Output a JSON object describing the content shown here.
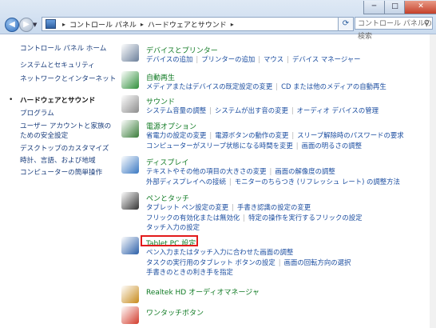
{
  "window": {
    "min_label": "─",
    "max_label": "□",
    "close_label": "✕"
  },
  "nav": {
    "back_glyph": "◀",
    "forward_glyph": "▶",
    "dropdown_glyph": "▼",
    "refresh_glyph": "⟳"
  },
  "address": {
    "sep": "▸",
    "crumbs": [
      "コントロール パネル",
      "ハードウェアとサウンド"
    ]
  },
  "search": {
    "placeholder": "コントロール パネルの検索",
    "icon": "magnifier-icon"
  },
  "sidebar": {
    "items": [
      "コントロール パネル ホーム",
      "システムとセキュリティ",
      "ネットワークとインターネット",
      "ハードウェアとサウンド",
      "プログラム",
      "ユーザー アカウントと家族の",
      "ための安全設定",
      "デスクトップのカスタマイズ",
      "時計、言語、および地域",
      "コンピューターの簡単操作"
    ]
  },
  "categories": [
    {
      "title": "デバイスとプリンター",
      "icon": "printer-icon",
      "lines": [
        [
          "デバイスの追加",
          "プリンターの追加",
          "マウス",
          "デバイス マネージャー"
        ]
      ]
    },
    {
      "title": "自動再生",
      "icon": "autoplay-icon",
      "lines": [
        [
          "メディアまたはデバイスの既定設定の変更",
          "CD または他のメディアの自動再生"
        ]
      ]
    },
    {
      "title": "サウンド",
      "icon": "speaker-icon",
      "lines": [
        [
          "システム音量の調整",
          "システムが出す音の変更",
          "オーディオ デバイスの管理"
        ]
      ]
    },
    {
      "title": "電源オプション",
      "icon": "power-icon",
      "lines": [
        [
          "省電力の設定の変更",
          "電源ボタンの動作の変更",
          "スリープ解除時のパスワードの要求"
        ],
        [
          "コンピューターがスリープ状態になる時間を変更",
          "画面の明るさの調整"
        ]
      ]
    },
    {
      "title": "ディスプレイ",
      "icon": "display-icon",
      "lines": [
        [
          "テキストやその他の項目の大きさの変更",
          "画面の解像度の調整"
        ],
        [
          "外部ディスプレイへの接続",
          "モニターのちらつき (リフレッシュ レート) の調整方法"
        ]
      ]
    },
    {
      "title": "ペンとタッチ",
      "icon": "pen-icon",
      "lines": [
        [
          "タブレット ペン設定の変更",
          "手書き認識の設定の変更"
        ],
        [
          "フリックの有効化または無効化",
          "特定の操作を実行するフリックの設定"
        ],
        [
          "タッチ入力の設定"
        ]
      ]
    },
    {
      "title": "Tablet PC 設定",
      "icon": "tablet-icon",
      "lines": [
        [
          "ペン入力またはタッチ入力に合わせた画面の調整"
        ],
        [
          "タスクの実行用のタブレット ボタンの設定",
          "画面の回転方向の選択"
        ],
        [
          "手書きのときの利き手を指定"
        ]
      ]
    },
    {
      "title": "Realtek HD オーディオマネージャ",
      "icon": "realtek-icon",
      "lines": []
    },
    {
      "title": "ワンタッチボタン",
      "icon": "onetouch-icon",
      "lines": []
    }
  ]
}
